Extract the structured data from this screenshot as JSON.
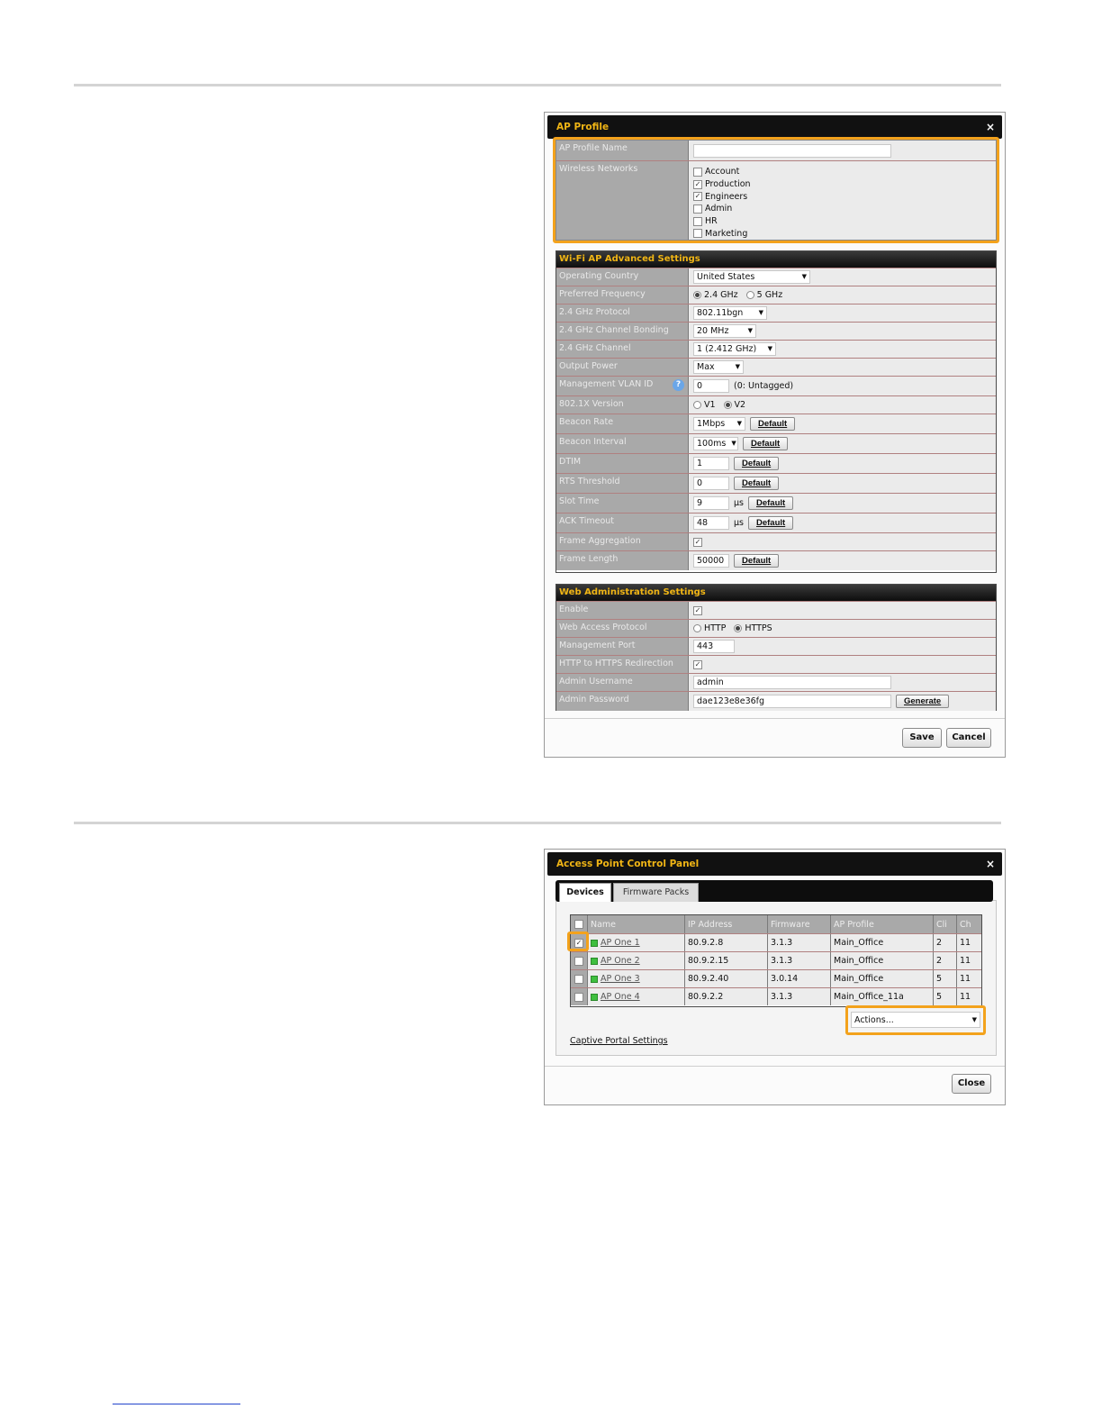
{
  "ap_profile": {
    "title": "AP Profile",
    "close_glyph": "×",
    "name_label": "AP Profile Name",
    "name_value": "",
    "wireless_label": "Wireless Networks",
    "networks": [
      {
        "name": "Account",
        "checked": false
      },
      {
        "name": "Production",
        "checked": true
      },
      {
        "name": "Engineers",
        "checked": true
      },
      {
        "name": "Admin",
        "checked": false
      },
      {
        "name": "HR",
        "checked": false
      },
      {
        "name": "Marketing",
        "checked": false
      }
    ],
    "advanced": {
      "header": "Wi-Fi AP Advanced Settings",
      "operating_country_label": "Operating Country",
      "operating_country_value": "United States",
      "preferred_frequency_label": "Preferred Frequency",
      "freq_24": "2.4 GHz",
      "freq_5": "5 GHz",
      "protocol_label": "2.4 GHz Protocol",
      "protocol_value": "802.11bgn",
      "bonding_label": "2.4 GHz Channel Bonding",
      "bonding_value": "20 MHz",
      "channel_label": "2.4 GHz Channel",
      "channel_value": "1 (2.412 GHz)",
      "output_power_label": "Output Power",
      "output_power_value": "Max",
      "vlan_label": "Management VLAN ID",
      "vlan_value": "0",
      "vlan_hint": "(0: Untagged)",
      "help_glyph": "?",
      "dot1x_label": "802.1X Version",
      "dot1x_v1": "V1",
      "dot1x_v2": "V2",
      "beacon_rate_label": "Beacon Rate",
      "beacon_rate_value": "1Mbps",
      "beacon_interval_label": "Beacon Interval",
      "beacon_interval_value": "100ms",
      "dtim_label": "DTIM",
      "dtim_value": "1",
      "rts_label": "RTS Threshold",
      "rts_value": "0",
      "slot_label": "Slot Time",
      "slot_value": "9",
      "ack_label": "ACK Timeout",
      "ack_value": "48",
      "unit_us": "μs",
      "frame_agg_label": "Frame Aggregation",
      "frame_len_label": "Frame Length",
      "frame_len_value": "50000",
      "default_label": "Default"
    },
    "web_admin": {
      "header": "Web Administration Settings",
      "enable_label": "Enable",
      "protocol_label": "Web Access Protocol",
      "http": "HTTP",
      "https": "HTTPS",
      "port_label": "Management Port",
      "port_value": "443",
      "redirect_label": "HTTP to HTTPS Redirection",
      "username_label": "Admin Username",
      "username_value": "admin",
      "password_label": "Admin Password",
      "password_value": "dae123e8e36fg",
      "generate_label": "Generate"
    },
    "save_label": "Save",
    "cancel_label": "Cancel"
  },
  "control_panel": {
    "title": "Access Point Control Panel",
    "close_glyph": "×",
    "tabs": [
      "Devices",
      "Firmware Packs"
    ],
    "columns": [
      "Name",
      "IP Address",
      "Firmware",
      "AP Profile",
      "Cli",
      "Ch"
    ],
    "rows": [
      {
        "checked": true,
        "name": "AP One 1",
        "ip": "80.9.2.8",
        "firmware": "3.1.3",
        "profile": "Main_Office",
        "cli": "2",
        "ch": "11"
      },
      {
        "checked": false,
        "name": "AP One 2",
        "ip": "80.9.2.15",
        "firmware": "3.1.3",
        "profile": "Main_Office",
        "cli": "2",
        "ch": "11"
      },
      {
        "checked": false,
        "name": "AP One 3",
        "ip": "80.9.2.40",
        "firmware": "3.0.14",
        "profile": "Main_Office",
        "cli": "5",
        "ch": "11"
      },
      {
        "checked": false,
        "name": "AP One 4",
        "ip": "80.9.2.2",
        "firmware": "3.1.3",
        "profile": "Main_Office_11a",
        "cli": "5",
        "ch": "11"
      }
    ],
    "actions_value": "Actions...",
    "captive_portal_link": "Captive Portal Settings",
    "close_label": "Close"
  },
  "colors": {
    "accent": "#f3a21c",
    "title_text": "#f0b515",
    "titlebar_bg": "#111111",
    "label_bg": "#a9a9a9"
  },
  "icons": [
    "close-icon",
    "help-icon",
    "checkbox-icon",
    "radio-icon",
    "dropdown-caret-icon",
    "status-dot-icon"
  ]
}
